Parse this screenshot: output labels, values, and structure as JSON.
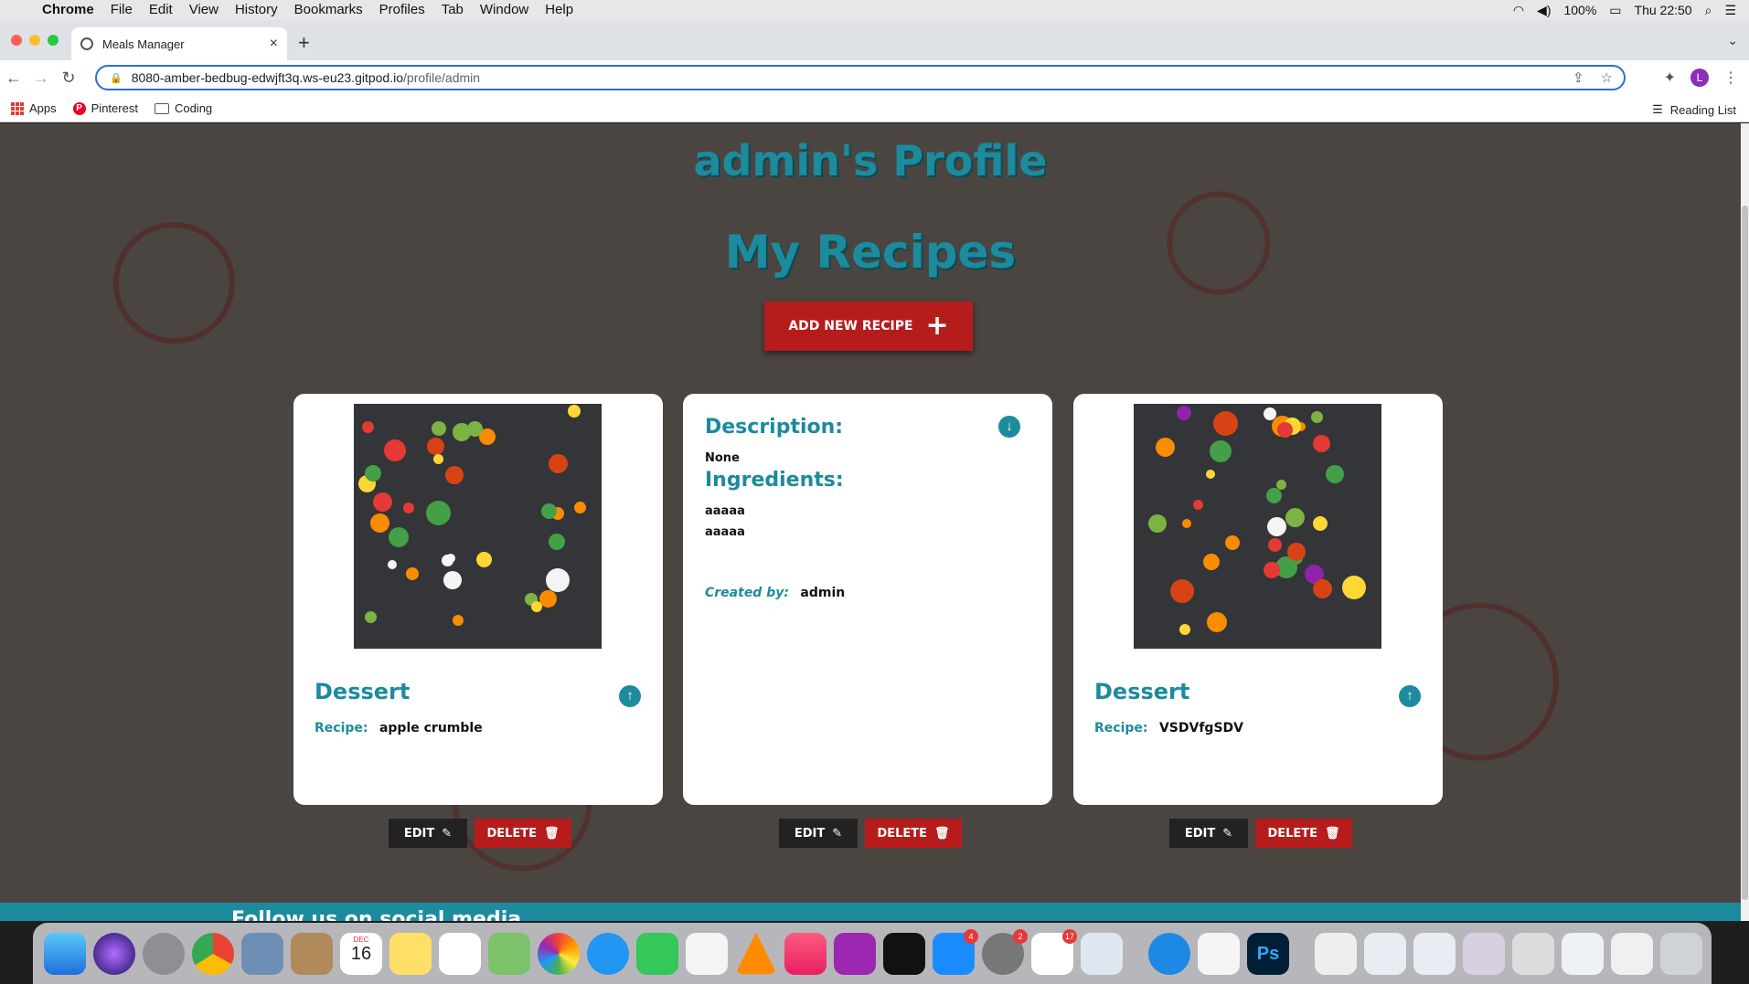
{
  "menubar": {
    "app": "Chrome",
    "items": [
      "File",
      "Edit",
      "View",
      "History",
      "Bookmarks",
      "Profiles",
      "Tab",
      "Window",
      "Help"
    ],
    "battery": "100%",
    "clock": "Thu 22:50"
  },
  "browser": {
    "tab_title": "Meals Manager",
    "url_host": "8080-amber-bedbug-edwjft3q.ws-eu23.gitpod.io",
    "url_path": "/profile/admin",
    "profile_initial": "L",
    "bookmarks": [
      "Apps",
      "Pinterest",
      "Coding"
    ],
    "reading_list": "Reading List"
  },
  "page": {
    "profile_heading": "admin's Profile",
    "recipes_heading": "My Recipes",
    "add_button": "ADD NEW RECIPE",
    "cards": [
      {
        "category": "Dessert",
        "recipe_label": "Recipe:",
        "recipe_name": "apple crumble"
      },
      {
        "description_label": "Description:",
        "description": "None",
        "ingredients_label": "Ingredients:",
        "ingredients": [
          "aaaaa",
          "aaaaa"
        ],
        "created_label": "Created by:",
        "created_by": "admin"
      },
      {
        "category": "Dessert",
        "recipe_label": "Recipe:",
        "recipe_name": "VSDVfgSDV"
      }
    ],
    "edit_label": "EDIT",
    "delete_label": "DELETE",
    "footer_text": "Follow us on social media"
  },
  "dock": {
    "badges": {
      "appstore": "4",
      "settings": "2",
      "slack": "17"
    },
    "calendar_month": "DEC",
    "calendar_day": "16"
  },
  "colors": {
    "accent": "#1c8b9d",
    "danger": "#b71c1c",
    "dark_button": "#222222"
  }
}
